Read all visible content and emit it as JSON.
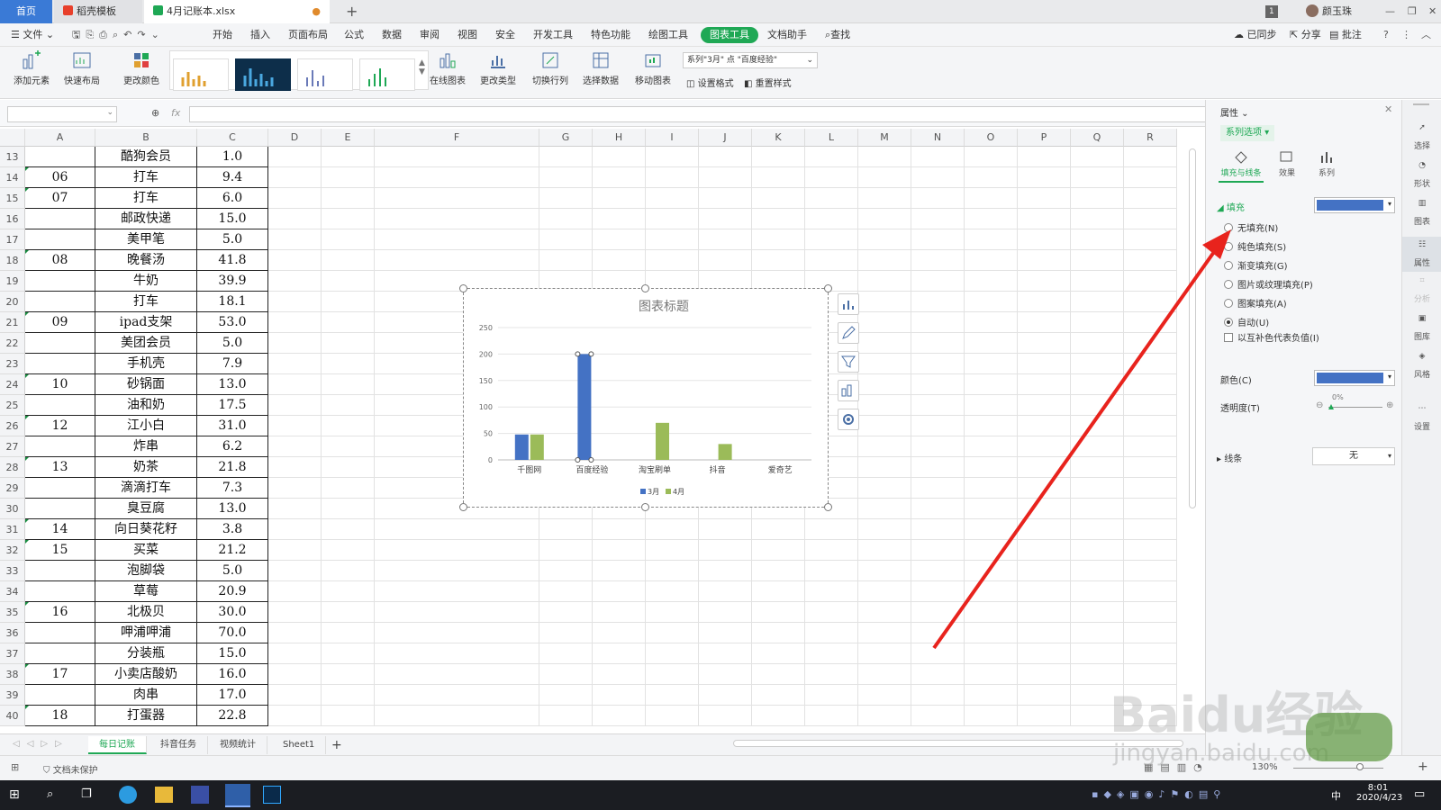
{
  "titlebar": {
    "tabs": [
      {
        "label": "首页"
      },
      {
        "label": "稻壳模板"
      },
      {
        "label": "4月记账本.xlsx"
      }
    ],
    "user": "颜玉珠",
    "badge": "1"
  },
  "menubar": {
    "file": "文件",
    "items": [
      "开始",
      "插入",
      "页面布局",
      "公式",
      "数据",
      "审阅",
      "视图",
      "安全",
      "开发工具",
      "特色功能",
      "绘图工具",
      "图表工具",
      "文档助手"
    ],
    "active_index": 11,
    "search": "查找",
    "sync": "已同步",
    "share": "分享",
    "comment": "批注"
  },
  "ribbon": {
    "buttons_left": [
      "添加元素",
      "快速布局",
      "更改颜色"
    ],
    "buttons_right": [
      "在线图表",
      "更改类型",
      "切换行列",
      "选择数据",
      "移动图表"
    ],
    "series_select": "系列\"3月\" 点 \"百度经验\"",
    "set_format": "设置格式",
    "reset_style": "重置样式"
  },
  "formula": {
    "name_box": "",
    "fx": "fx",
    "value": ""
  },
  "sheet": {
    "columns": [
      "A",
      "B",
      "C",
      "D",
      "E",
      "F",
      "G",
      "H",
      "I",
      "J",
      "K",
      "L",
      "M",
      "N",
      "O",
      "P",
      "Q",
      "R"
    ],
    "rows": [
      {
        "n": "13",
        "a": "",
        "b": "酷狗会员",
        "c": "1.0"
      },
      {
        "n": "14",
        "a": "06",
        "b": "打车",
        "c": "9.4"
      },
      {
        "n": "15",
        "a": "07",
        "b": "打车",
        "c": "6.0"
      },
      {
        "n": "16",
        "a": "",
        "b": "邮政快递",
        "c": "15.0"
      },
      {
        "n": "17",
        "a": "",
        "b": "美甲笔",
        "c": "5.0"
      },
      {
        "n": "18",
        "a": "08",
        "b": "晚餐汤",
        "c": "41.8"
      },
      {
        "n": "19",
        "a": "",
        "b": "牛奶",
        "c": "39.9"
      },
      {
        "n": "20",
        "a": "",
        "b": "打车",
        "c": "18.1"
      },
      {
        "n": "21",
        "a": "09",
        "b": "ipad支架",
        "c": "53.0"
      },
      {
        "n": "22",
        "a": "",
        "b": "美团会员",
        "c": "5.0"
      },
      {
        "n": "23",
        "a": "",
        "b": "手机壳",
        "c": "7.9"
      },
      {
        "n": "24",
        "a": "10",
        "b": "砂锅面",
        "c": "13.0"
      },
      {
        "n": "25",
        "a": "",
        "b": "油和奶",
        "c": "17.5"
      },
      {
        "n": "26",
        "a": "12",
        "b": "江小白",
        "c": "31.0"
      },
      {
        "n": "27",
        "a": "",
        "b": "炸串",
        "c": "6.2"
      },
      {
        "n": "28",
        "a": "13",
        "b": "奶茶",
        "c": "21.8"
      },
      {
        "n": "29",
        "a": "",
        "b": "滴滴打车",
        "c": "7.3"
      },
      {
        "n": "30",
        "a": "",
        "b": "臭豆腐",
        "c": "13.0"
      },
      {
        "n": "31",
        "a": "14",
        "b": "向日葵花籽",
        "c": "3.8"
      },
      {
        "n": "32",
        "a": "15",
        "b": "买菜",
        "c": "21.2"
      },
      {
        "n": "33",
        "a": "",
        "b": "泡脚袋",
        "c": "5.0"
      },
      {
        "n": "34",
        "a": "",
        "b": "草莓",
        "c": "20.9"
      },
      {
        "n": "35",
        "a": "16",
        "b": "北极贝",
        "c": "30.0"
      },
      {
        "n": "36",
        "a": "",
        "b": "呷浦呷浦",
        "c": "70.0"
      },
      {
        "n": "37",
        "a": "",
        "b": "分装瓶",
        "c": "15.0"
      },
      {
        "n": "38",
        "a": "17",
        "b": "小卖店酸奶",
        "c": "16.0"
      },
      {
        "n": "39",
        "a": "",
        "b": "肉串",
        "c": "17.0"
      },
      {
        "n": "40",
        "a": "18",
        "b": "打蛋器",
        "c": "22.8"
      }
    ]
  },
  "chart_data": {
    "type": "bar",
    "title": "图表标题",
    "categories": [
      "千图网",
      "百度经验",
      "淘宝刷单",
      "抖音",
      "爱奇艺"
    ],
    "series": [
      {
        "name": "3月",
        "values": [
          48,
          200,
          0,
          0,
          0
        ],
        "color": "#4472c4"
      },
      {
        "name": "4月",
        "values": [
          48,
          0,
          70,
          30,
          0
        ],
        "color": "#9bbb59"
      }
    ],
    "yticks": [
      "0",
      "50",
      "100",
      "150",
      "200",
      "250"
    ],
    "ylim": [
      0,
      250
    ],
    "grid": true,
    "legend": "bottom"
  },
  "sheet_tabs": [
    "每日记账",
    "抖音任务",
    "视频统计",
    "Sheet1"
  ],
  "active_sheet": 0,
  "status": {
    "protect": "文档未保护",
    "zoom": "130%"
  },
  "panel": {
    "title": "属性",
    "series_option": "系列选项",
    "tabs": [
      "填充与线条",
      "效果",
      "系列"
    ],
    "fill_label": "填充",
    "fill_color": "#4472c4",
    "fill_options": [
      "无填充(N)",
      "纯色填充(S)",
      "渐变填充(G)",
      "图片或纹理填充(P)",
      "图案填充(A)",
      "自动(U)"
    ],
    "selected_fill": 5,
    "invert_label": "以互补色代表负值(I)",
    "color_label": "颜色(C)",
    "transparency_label": "透明度(T)",
    "transparency_value": "0%",
    "line_label": "线条",
    "line_value": "无"
  },
  "sidebar": [
    "选择",
    "形状",
    "图表",
    "属性",
    "分析",
    "图库",
    "风格",
    "设置"
  ],
  "taskbar": {
    "time": "8:01",
    "date": "2020/4/23",
    "ime": "中"
  },
  "watermark": {
    "text": "Baidu经验",
    "url": "jingyan.baidu.com"
  },
  "colors": {
    "accent": "#1fa855",
    "home_tab": "#3a7ad6",
    "arrow": "#e8231d"
  }
}
